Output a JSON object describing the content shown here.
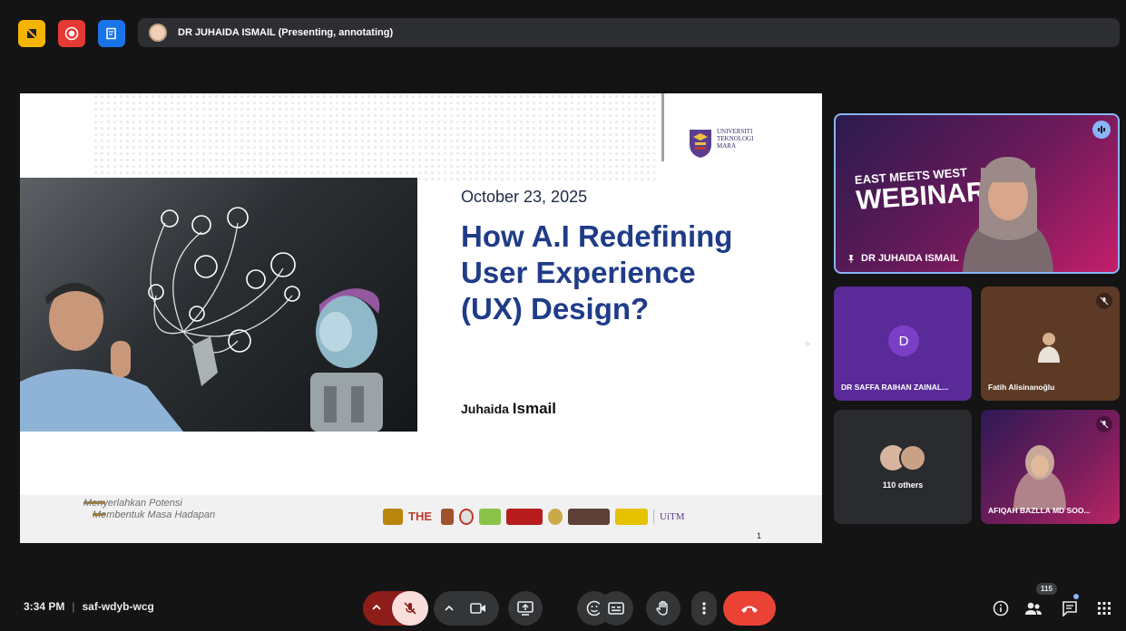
{
  "presenter_bar": {
    "label": "DR JUHAIDA ISMAIL (Presenting, annotating)"
  },
  "slide": {
    "date": "October 23, 2025",
    "title": "How A.I Redefining User Experience (UX) Design?",
    "author_first": "Juhaida",
    "author_last": "Ismail",
    "tagline_line1": "Menyerlahkan Potensi",
    "tagline_line2": "Membentuk Masa Hadapan",
    "university_line1": "UNIVERSITI",
    "university_line2": "TEKNOLOGI",
    "university_line3": "MARA",
    "page_number": "1",
    "footer_logo_text_1": "THE",
    "footer_logo_text_2": "UiTM"
  },
  "tiles": {
    "main": {
      "name": "DR JUHAIDA ISMAIL",
      "banner_line1": "EAST MEETS WEST",
      "banner_line2": "WEBINAR"
    },
    "saffa": {
      "name": "DR SAFFA RAIHAN ZAINAL...",
      "initial": "D"
    },
    "fatih": {
      "name": "Fatih Alisinanoğlu"
    },
    "others": {
      "label": "110 others"
    },
    "afiqah": {
      "name": "AFIQAH BAZLLA MD SOO..."
    }
  },
  "bottom": {
    "time": "3:34 PM",
    "meeting_code": "saf-wdyb-wcg",
    "participant_count": "115"
  },
  "colors": {
    "accent": "#8ab4f8",
    "end_call": "#ea4335",
    "mic_off_bg": "#f9dedc",
    "title_blue": "#1f3c88"
  }
}
